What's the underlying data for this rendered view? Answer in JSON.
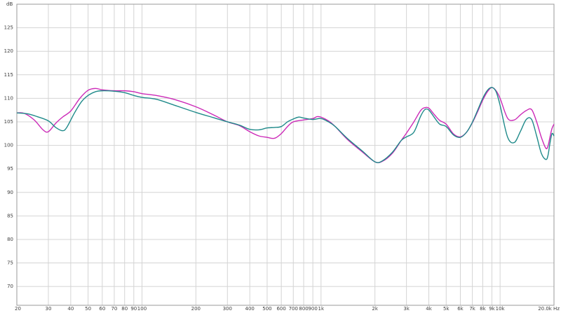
{
  "chart_data": {
    "type": "line",
    "title": "",
    "ylabel": "dB",
    "xlabel": "Hz",
    "xscale": "log",
    "xlim": [
      20,
      20000
    ],
    "ylim": [
      66,
      130
    ],
    "grid": true,
    "legend": "none",
    "y_ticks": [
      70,
      75,
      80,
      85,
      90,
      95,
      100,
      105,
      110,
      115,
      120,
      125
    ],
    "x_ticks": [
      {
        "value": 20,
        "label": "20"
      },
      {
        "value": 30,
        "label": "30"
      },
      {
        "value": 40,
        "label": "40"
      },
      {
        "value": 50,
        "label": "50"
      },
      {
        "value": 60,
        "label": "60"
      },
      {
        "value": 70,
        "label": "70"
      },
      {
        "value": 80,
        "label": "80"
      },
      {
        "value": 90,
        "label": "90"
      },
      {
        "value": 100,
        "label": "100"
      },
      {
        "value": 200,
        "label": "200"
      },
      {
        "value": 300,
        "label": "300"
      },
      {
        "value": 400,
        "label": "400"
      },
      {
        "value": 500,
        "label": "500"
      },
      {
        "value": 600,
        "label": "600"
      },
      {
        "value": 700,
        "label": "700"
      },
      {
        "value": 800,
        "label": "800"
      },
      {
        "value": 900,
        "label": "900"
      },
      {
        "value": 1000,
        "label": "1k"
      },
      {
        "value": 2000,
        "label": "2k"
      },
      {
        "value": 3000,
        "label": "3k"
      },
      {
        "value": 4000,
        "label": "4k"
      },
      {
        "value": 5000,
        "label": "5k"
      },
      {
        "value": 6000,
        "label": "6k"
      },
      {
        "value": 7000,
        "label": "7k"
      },
      {
        "value": 8000,
        "label": "8k"
      },
      {
        "value": 9000,
        "label": "9k"
      },
      {
        "value": 10000,
        "label": "10k"
      },
      {
        "value": 20000,
        "label": "20.0k Hz"
      }
    ],
    "series": [
      {
        "color": "#cc2ab8",
        "points": [
          [
            20,
            106.9
          ],
          [
            22,
            106.8
          ],
          [
            25,
            105.4
          ],
          [
            28,
            103.3
          ],
          [
            30,
            102.9
          ],
          [
            33,
            104.7
          ],
          [
            36,
            106.0
          ],
          [
            40,
            107.3
          ],
          [
            45,
            110.0
          ],
          [
            50,
            111.7
          ],
          [
            55,
            112.1
          ],
          [
            60,
            111.8
          ],
          [
            70,
            111.6
          ],
          [
            80,
            111.6
          ],
          [
            90,
            111.4
          ],
          [
            100,
            111.0
          ],
          [
            120,
            110.6
          ],
          [
            150,
            109.8
          ],
          [
            200,
            108.2
          ],
          [
            250,
            106.5
          ],
          [
            300,
            105.0
          ],
          [
            350,
            104.2
          ],
          [
            400,
            102.9
          ],
          [
            450,
            102.0
          ],
          [
            500,
            101.7
          ],
          [
            550,
            101.5
          ],
          [
            600,
            102.5
          ],
          [
            650,
            104.0
          ],
          [
            700,
            105.0
          ],
          [
            800,
            105.4
          ],
          [
            900,
            105.7
          ],
          [
            950,
            106.1
          ],
          [
            1000,
            106.0
          ],
          [
            1100,
            105.2
          ],
          [
            1200,
            104.0
          ],
          [
            1400,
            101.3
          ],
          [
            1700,
            98.6
          ],
          [
            2000,
            96.5
          ],
          [
            2200,
            96.6
          ],
          [
            2500,
            98.3
          ],
          [
            2800,
            101.0
          ],
          [
            3000,
            102.6
          ],
          [
            3300,
            105.0
          ],
          [
            3600,
            107.4
          ],
          [
            3800,
            108.0
          ],
          [
            4000,
            107.9
          ],
          [
            4300,
            106.5
          ],
          [
            4600,
            105.3
          ],
          [
            5000,
            104.5
          ],
          [
            5500,
            102.4
          ],
          [
            6000,
            101.8
          ],
          [
            6500,
            102.8
          ],
          [
            7000,
            104.8
          ],
          [
            7500,
            107.2
          ],
          [
            8000,
            109.6
          ],
          [
            8500,
            111.4
          ],
          [
            9000,
            112.3
          ],
          [
            9500,
            111.6
          ],
          [
            10000,
            110.0
          ],
          [
            11000,
            105.8
          ],
          [
            12000,
            105.4
          ],
          [
            13000,
            106.5
          ],
          [
            14000,
            107.4
          ],
          [
            15000,
            107.6
          ],
          [
            16000,
            105.0
          ],
          [
            17000,
            101.7
          ],
          [
            18000,
            99.4
          ],
          [
            18500,
            99.8
          ],
          [
            19000,
            101.8
          ],
          [
            19500,
            103.6
          ],
          [
            20000,
            104.5
          ]
        ]
      },
      {
        "color": "#1f8a8a",
        "points": [
          [
            20,
            106.9
          ],
          [
            23,
            106.7
          ],
          [
            26,
            106.1
          ],
          [
            30,
            105.2
          ],
          [
            33,
            103.8
          ],
          [
            36,
            103.1
          ],
          [
            38,
            103.8
          ],
          [
            42,
            106.9
          ],
          [
            46,
            109.3
          ],
          [
            50,
            110.6
          ],
          [
            55,
            111.4
          ],
          [
            60,
            111.6
          ],
          [
            70,
            111.5
          ],
          [
            80,
            111.2
          ],
          [
            90,
            110.6
          ],
          [
            100,
            110.2
          ],
          [
            120,
            109.8
          ],
          [
            150,
            108.6
          ],
          [
            200,
            107.0
          ],
          [
            250,
            105.9
          ],
          [
            300,
            105.0
          ],
          [
            350,
            104.3
          ],
          [
            400,
            103.4
          ],
          [
            450,
            103.3
          ],
          [
            500,
            103.7
          ],
          [
            550,
            103.8
          ],
          [
            600,
            104.0
          ],
          [
            650,
            105.0
          ],
          [
            700,
            105.6
          ],
          [
            750,
            106.0
          ],
          [
            800,
            105.8
          ],
          [
            900,
            105.5
          ],
          [
            1000,
            105.7
          ],
          [
            1100,
            105.0
          ],
          [
            1200,
            104.0
          ],
          [
            1400,
            101.5
          ],
          [
            1700,
            98.8
          ],
          [
            2000,
            96.5
          ],
          [
            2200,
            96.7
          ],
          [
            2500,
            98.5
          ],
          [
            2800,
            101.0
          ],
          [
            3000,
            101.8
          ],
          [
            3300,
            102.8
          ],
          [
            3600,
            106.2
          ],
          [
            3800,
            107.6
          ],
          [
            4000,
            107.5
          ],
          [
            4300,
            105.9
          ],
          [
            4600,
            104.5
          ],
          [
            5000,
            104.0
          ],
          [
            5500,
            102.2
          ],
          [
            6000,
            101.7
          ],
          [
            6500,
            102.8
          ],
          [
            7000,
            104.9
          ],
          [
            7500,
            107.5
          ],
          [
            8000,
            110.0
          ],
          [
            8500,
            111.7
          ],
          [
            9000,
            112.3
          ],
          [
            9500,
            111.4
          ],
          [
            10000,
            108.5
          ],
          [
            11000,
            101.8
          ],
          [
            12000,
            100.6
          ],
          [
            13000,
            103.0
          ],
          [
            14000,
            105.5
          ],
          [
            15000,
            105.5
          ],
          [
            16000,
            102.0
          ],
          [
            17000,
            98.3
          ],
          [
            18000,
            97.0
          ],
          [
            18500,
            97.8
          ],
          [
            19000,
            100.5
          ],
          [
            19500,
            102.5
          ],
          [
            20000,
            102.0
          ]
        ]
      }
    ]
  }
}
